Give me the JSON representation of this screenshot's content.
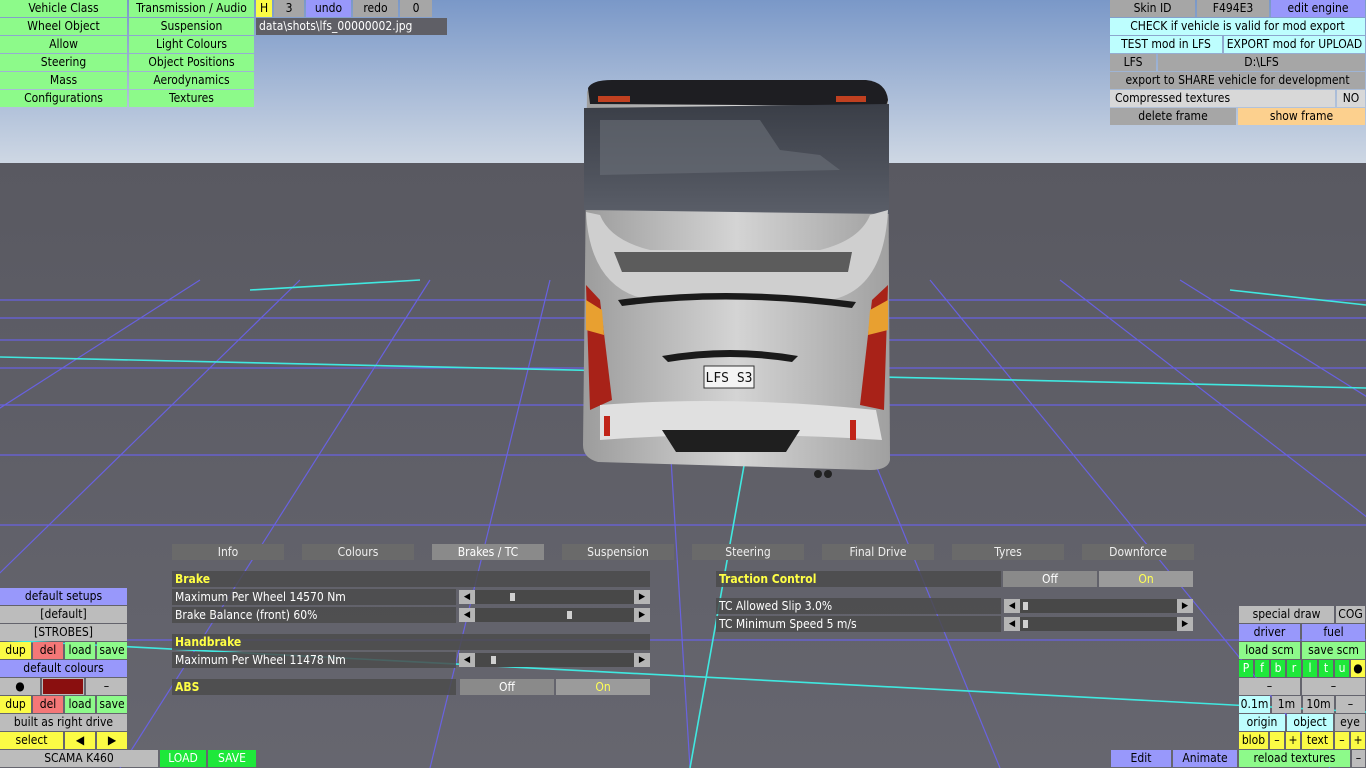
{
  "top_left": {
    "col1": [
      "Vehicle Class",
      "Wheel Object",
      "Allow",
      "Steering",
      "Mass",
      "Configurations"
    ],
    "col2": [
      "Transmission / Audio",
      "Suspension",
      "Light Colours",
      "Object Positions",
      "Aerodynamics",
      "Textures"
    ],
    "h_label": "H",
    "h_value": "3",
    "undo_label": "undo",
    "redo_label": "redo",
    "redo_count": "0"
  },
  "screenshot_path": "data\\shots\\lfs_00000002.jpg",
  "top_right": {
    "skin_id_label": "Skin ID",
    "skin_id_value": "F494E3",
    "edit_engine": "edit engine",
    "check_valid": "CHECK if vehicle is valid for mod export",
    "test_mod": "TEST mod in LFS",
    "export_upload": "EXPORT mod for UPLOAD",
    "lfs_label": "LFS",
    "lfs_path": "D:\\LFS",
    "export_share": "export to SHARE vehicle for development",
    "compressed_label": "Compressed textures",
    "compressed_value": "NO",
    "delete_frame": "delete frame",
    "show_frame": "show frame"
  },
  "plate_text": "LFS S3",
  "tabs": [
    "Info",
    "Colours",
    "Brakes / TC",
    "Suspension",
    "Steering",
    "Final Drive",
    "Tyres",
    "Downforce"
  ],
  "active_tab": "Brakes / TC",
  "brakes": {
    "brake_header": "Brake",
    "max_per_wheel": "Maximum Per Wheel 14570 Nm",
    "max_per_wheel_level": 0.22,
    "balance": "Brake Balance (front) 60%",
    "balance_level": 0.6,
    "handbrake_header": "Handbrake",
    "hb_max": "Maximum Per Wheel 11478 Nm",
    "hb_level": 0.09,
    "abs_label": "ABS",
    "abs_off": "Off",
    "abs_on": "On"
  },
  "traction": {
    "header": "Traction Control",
    "off": "Off",
    "on": "On",
    "slip": "TC Allowed Slip 3.0%",
    "slip_level": 0.01,
    "min_speed": "TC Minimum Speed 5 m/s",
    "min_speed_level": 0.01
  },
  "bottom_left": {
    "default_setups": "default setups",
    "default_item": "[default]",
    "strobes": "[STROBES]",
    "dup": "dup",
    "del": "del",
    "load": "load",
    "save": "save",
    "default_colours": "default colours",
    "dot": "●",
    "dash": "–",
    "right_drive": "built as right drive",
    "select": "select",
    "left_arrow": "◀",
    "right_arrow": "▶",
    "vehicle_name": "SCAMA K460",
    "load_btn": "LOAD",
    "save_btn": "SAVE",
    "colour_swatch": "#8a0f0f"
  },
  "bottom_right": {
    "special_draw": "special draw",
    "cog": "COG",
    "driver": "driver",
    "fuel": "fuel",
    "load_scm": "load scm",
    "save_scm": "save scm",
    "toggles": [
      "P",
      "f",
      "b",
      "r",
      "l",
      "t",
      "u",
      "●"
    ],
    "dash": "–",
    "dist": [
      "0.1m",
      "1m",
      "10m",
      "–"
    ],
    "origin": "origin",
    "object": "object",
    "eye": "eye",
    "blob": "blob",
    "minus": "–",
    "plus": "+",
    "text": "text",
    "edit": "Edit",
    "animate": "Animate",
    "reload_textures": "reload textures"
  }
}
